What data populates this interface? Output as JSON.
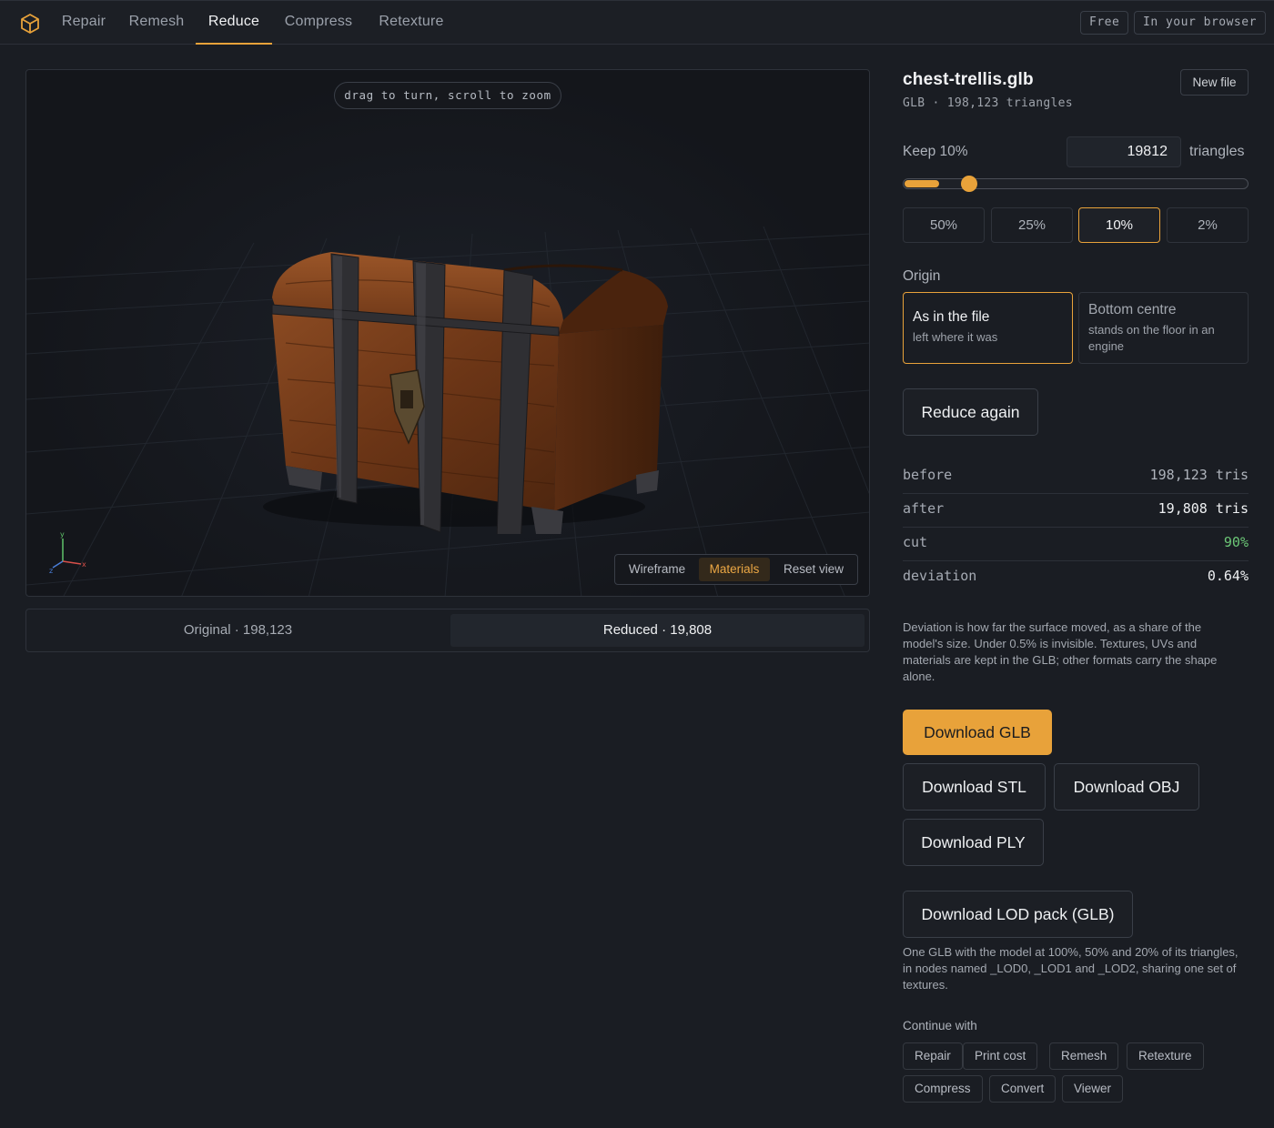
{
  "nav": {
    "tabs": [
      {
        "label": "Repair"
      },
      {
        "label": "Remesh"
      },
      {
        "label": "Reduce"
      },
      {
        "label": "Compress"
      },
      {
        "label": "Retexture"
      }
    ],
    "active_tab": "Reduce",
    "badges": [
      "Free",
      "In your browser"
    ]
  },
  "viewport": {
    "hint": "drag to turn, scroll to zoom",
    "view_modes": [
      "Wireframe",
      "Materials",
      "Reset view"
    ],
    "active_mode": "Materials",
    "axis_labels": {
      "x": "x",
      "y": "y",
      "z": "z"
    }
  },
  "compare": {
    "original": "Original · 198,123",
    "reduced": "Reduced · 19,808",
    "active": "reduced"
  },
  "file": {
    "name": "chest-trellis.glb",
    "meta": "GLB · 198,123 triangles",
    "new_file": "New file"
  },
  "reduce": {
    "keep_label": "Keep 10%",
    "target_value": "19812",
    "unit_label": "triangles",
    "slider_fraction": 0.1,
    "presets": [
      "50%",
      "25%",
      "10%",
      "2%"
    ],
    "active_preset": "10%"
  },
  "origin": {
    "label": "Origin",
    "options": [
      {
        "title": "As in the file",
        "sub": "left where it was"
      },
      {
        "title": "Bottom centre",
        "sub": "stands on the floor in an engine"
      }
    ],
    "active": 0
  },
  "actions": {
    "reduce_again": "Reduce again",
    "download_glb": "Download GLB",
    "download_stl": "Download STL",
    "download_obj": "Download OBJ",
    "download_ply": "Download PLY",
    "download_lod": "Download LOD pack (GLB)"
  },
  "stats": [
    {
      "key": "before",
      "value": "198,123 tris"
    },
    {
      "key": "after",
      "value": "19,808 tris"
    },
    {
      "key": "cut",
      "value": "90%"
    },
    {
      "key": "deviation",
      "value": "0.64%"
    }
  ],
  "notes": {
    "deviation": "Deviation is how far the surface moved, as a share of the model's size. Under 0.5% is invisible. Textures, UVs and materials are kept in the GLB; other formats carry the shape alone.",
    "lod": "One GLB with the model at 100%, 50% and 20% of its triangles, in nodes named _LOD0, _LOD1 and _LOD2, sharing one set of textures."
  },
  "continue": {
    "label": "Continue with",
    "items": [
      "Repair",
      "Print cost",
      "Remesh",
      "Retexture",
      "Compress",
      "Convert",
      "Viewer"
    ]
  },
  "colors": {
    "accent": "#e8a23a",
    "cut_value": "#6cc777",
    "background": "#1a1d23"
  }
}
